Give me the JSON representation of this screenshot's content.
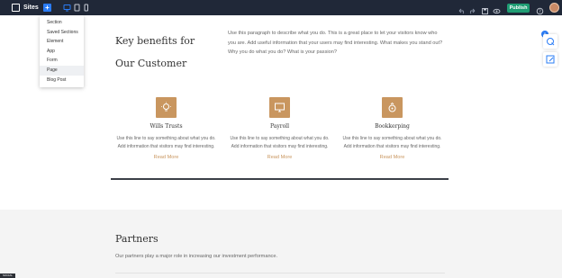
{
  "toolbar": {
    "site_label": "Sites",
    "add_label": "+",
    "publish_label": "Publish"
  },
  "add_menu": {
    "items": [
      {
        "label": "Section"
      },
      {
        "label": "Saved Sections"
      },
      {
        "label": "Element"
      },
      {
        "label": "App"
      },
      {
        "label": "Form"
      },
      {
        "label": "Page"
      },
      {
        "label": "Blog Post"
      }
    ]
  },
  "hero": {
    "title": "Key benefits for Our Customer",
    "paragraph": "Use this paragraph to describe what you do. This is a great place to let your visitors know who you are. Add useful information that your users may find interesting. What makes you stand out? Why you do what you do? What is your passion?"
  },
  "features": [
    {
      "title": "Wills Trusts",
      "desc": "Use this line to say something about what you do. Add information that visitors may find interesting.",
      "link": "Read More"
    },
    {
      "title": "Payroll",
      "desc": "Use this line to say something about what you do. Add information that visitors may find interesting.",
      "link": "Read More"
    },
    {
      "title": "Bookkerping",
      "desc": "Use this line to say something about what you do. Add information that visitors may find interesting.",
      "link": "Read More"
    }
  ],
  "partners": {
    "title": "Partners",
    "desc": "Our partners play a major role in increasing our investment performance."
  },
  "bottom_badge": "SOCIAL",
  "colors": {
    "topbar": "#202838",
    "accent_blue": "#2a7cf6",
    "publish_green": "#1f9d74",
    "feature_gold": "#c9965f"
  },
  "icons": {
    "features": [
      "lightbulb-icon",
      "monitor-icon",
      "piggy-bank-icon"
    ]
  }
}
